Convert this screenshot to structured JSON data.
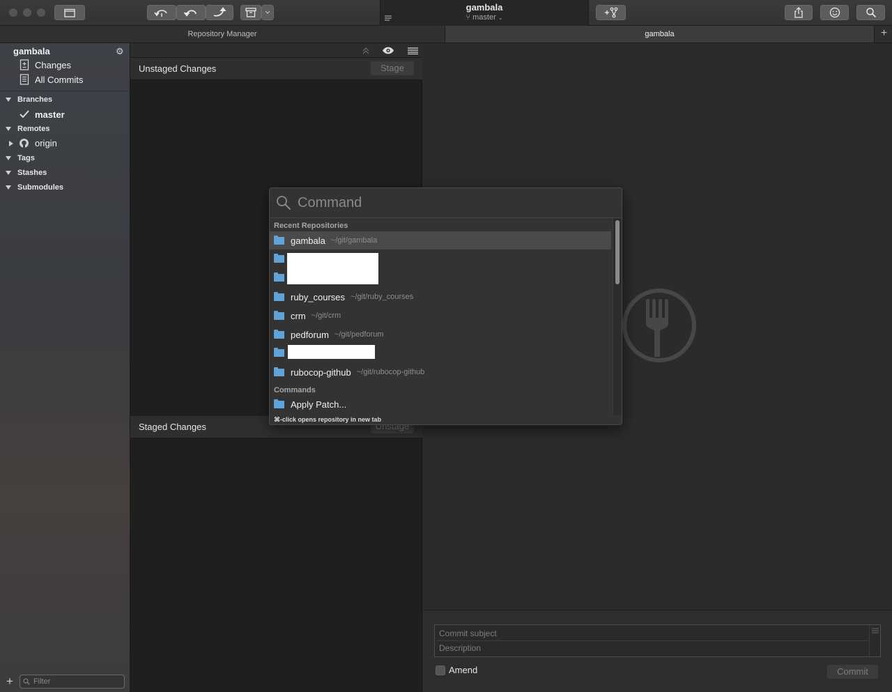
{
  "toolbar": {
    "title": "gambala",
    "branch": "master"
  },
  "tabs": {
    "repository_manager": "Repository Manager",
    "current": "gambala"
  },
  "sidebar": {
    "repo_name": "gambala",
    "changes": "Changes",
    "all_commits": "All Commits",
    "branches": "Branches",
    "current_branch": "master",
    "remotes": "Remotes",
    "remote_origin": "origin",
    "tags": "Tags",
    "stashes": "Stashes",
    "submodules": "Submodules",
    "filter_placeholder": "Filter"
  },
  "middle": {
    "unstaged_label": "Unstaged Changes",
    "stage_button": "Stage",
    "staged_label": "Staged Changes",
    "unstage_button": "Unstage"
  },
  "commit": {
    "subject_placeholder": "Commit subject",
    "description_placeholder": "Description",
    "amend_label": "Amend",
    "commit_button": "Commit"
  },
  "palette": {
    "placeholder": "Command",
    "recent_header": "Recent Repositories",
    "repos": [
      {
        "name": "gambala",
        "path": "~/git/gambala"
      },
      {
        "name": "ruby_courses",
        "path": "~/git/ruby_courses"
      },
      {
        "name": "crm",
        "path": "~/git/crm"
      },
      {
        "name": "pedforum",
        "path": "~/git/pedforum"
      },
      {
        "name": "rubocop-github",
        "path": "~/git/rubocop-github"
      }
    ],
    "commands_header": "Commands",
    "apply_patch": "Apply Patch...",
    "footer": "⌘-click opens repository in new tab"
  },
  "colors": {
    "folder": "#5fa3d9",
    "selection": "#4a4a4a",
    "background": "#2b2b2b"
  }
}
